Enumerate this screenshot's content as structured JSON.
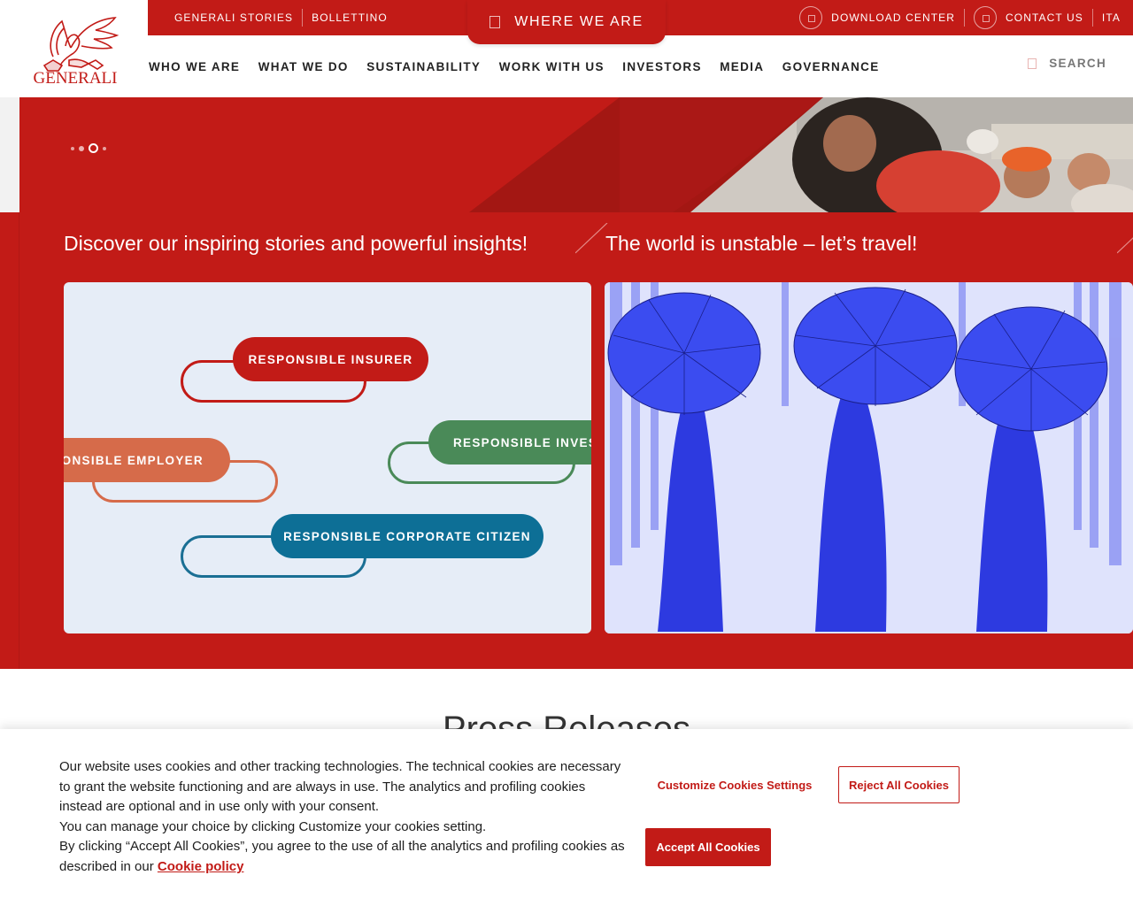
{
  "brand": {
    "name": "GENERALI",
    "primary_color": "#c21b17"
  },
  "topbar": {
    "left_links": [
      "GENERALI STORIES",
      "BOLLETTINO"
    ],
    "where_we_are": "WHERE WE ARE",
    "download_center": "DOWNLOAD CENTER",
    "contact_us": "CONTACT US",
    "language": "ITA"
  },
  "nav": {
    "items": [
      "WHO WE ARE",
      "WHAT WE DO",
      "SUSTAINABILITY",
      "WORK WITH US",
      "INVESTORS",
      "MEDIA",
      "GOVERNANCE"
    ],
    "search_label": "SEARCH"
  },
  "hero": {
    "slides": 4,
    "active_slide": 3
  },
  "stories": {
    "items": [
      {
        "title": "Discover our inspiring stories and powerful insights!",
        "pills": [
          "RESPONSIBLE INSURER",
          "SPONSIBLE EMPLOYER",
          "RESPONSIBLE INVEST",
          "RESPONSIBLE CORPORATE CITIZEN"
        ]
      },
      {
        "title": "The world is unstable – let’s travel!"
      }
    ]
  },
  "press": {
    "title": "Press Releases"
  },
  "cookie": {
    "line1": "Our website uses cookies and other tracking technologies. The technical cookies are necessary to grant the website functioning and are always in use. The analytics and profiling cookies instead are optional and in use only with your consent.",
    "line2": "You can manage your choice by clicking Customize your cookies setting.",
    "line3": "By clicking “Accept All Cookies”, you agree to the use of all the analytics and profiling cookies as described in our",
    "policy_link": "Cookie policy",
    "customize_label": "Customize Cookies Settings",
    "reject_label": "Reject All Cookies",
    "accept_label": "Accept All Cookies"
  }
}
